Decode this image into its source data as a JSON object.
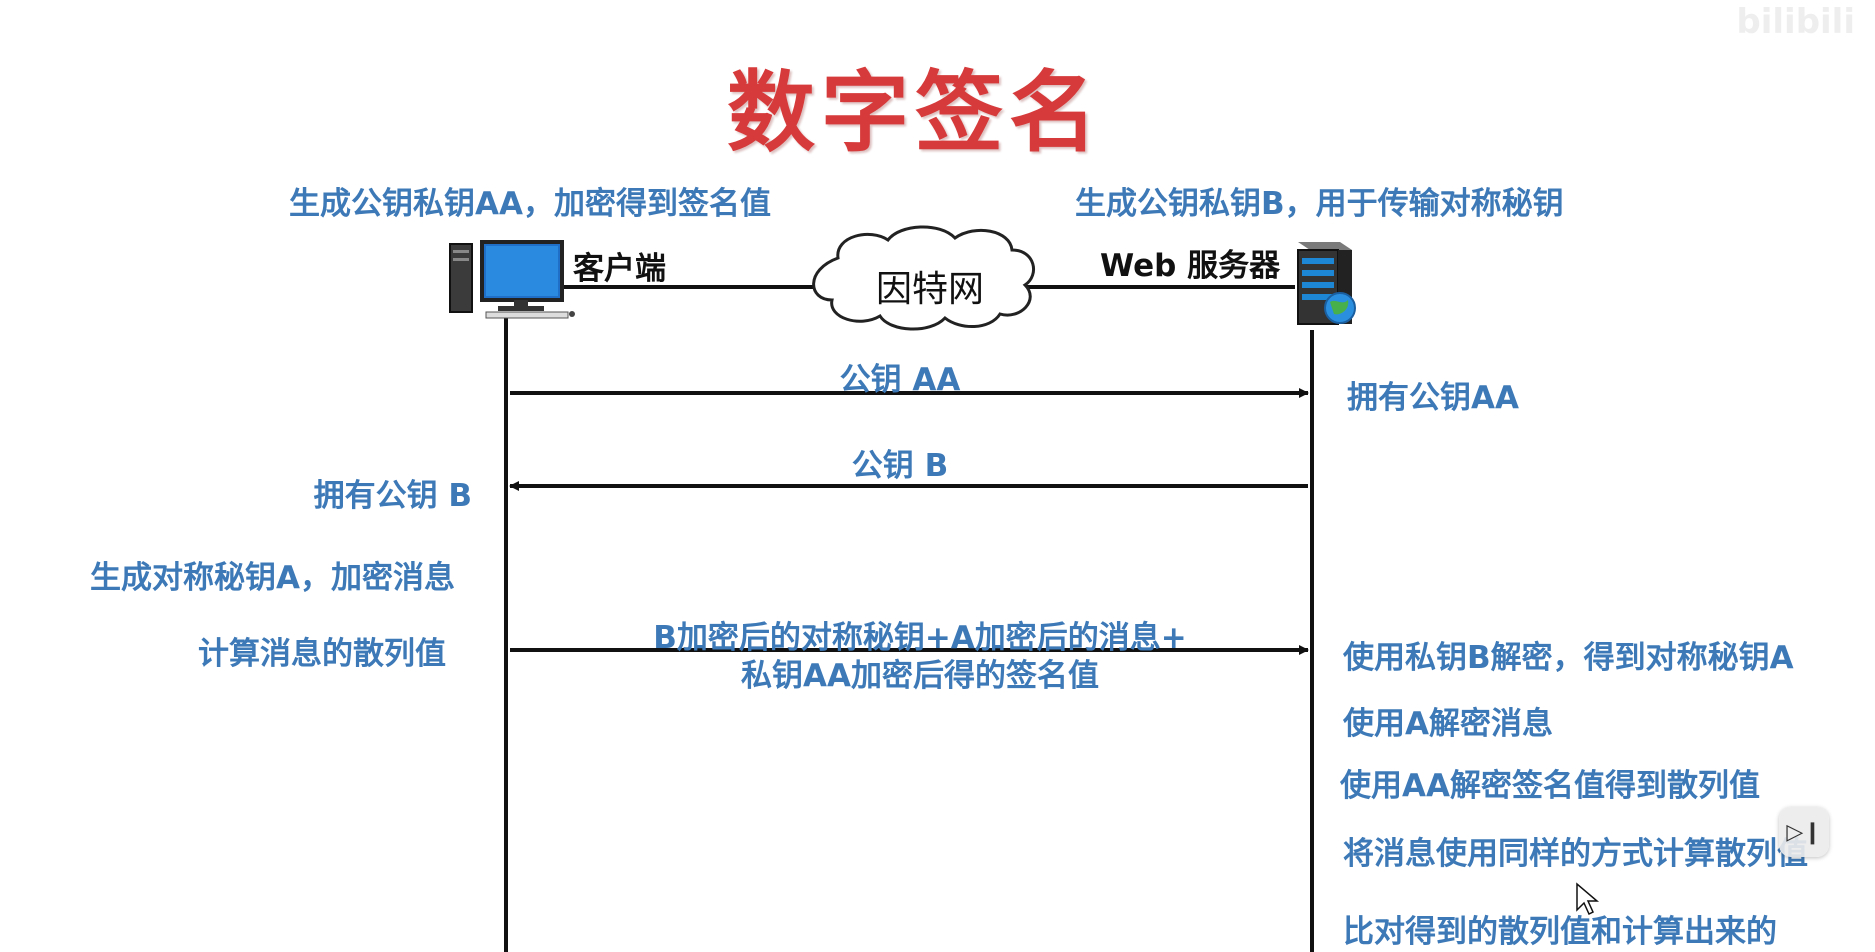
{
  "title": "数字签名",
  "watermark": "bilibili",
  "client": {
    "label": "客户端",
    "top_note": "生成公钥私钥AA，加密得到签名值",
    "notes": [
      "拥有公钥 B",
      "生成对称秘钥A，加密消息",
      "计算消息的散列值"
    ]
  },
  "server": {
    "label": "Web 服务器",
    "top_note": "生成公钥私钥B，用于传输对称秘钥",
    "notes": [
      "拥有公钥AA",
      "使用私钥B解密，得到对称秘钥A",
      "使用A解密消息",
      "使用AA解密签名值得到散列值",
      "将消息使用同样的方式计算散列值",
      "比对得到的散列值和计算出来的"
    ]
  },
  "internet": {
    "label": "因特网"
  },
  "messages": [
    {
      "label": "公钥 AA",
      "direction": "client-to-server"
    },
    {
      "label": "公钥 B",
      "direction": "server-to-client"
    },
    {
      "label_line1": "B加密后的对称秘钥+A加密后的消息+",
      "label_line2": "私钥AA加密后得的签名值",
      "direction": "client-to-server"
    }
  ]
}
